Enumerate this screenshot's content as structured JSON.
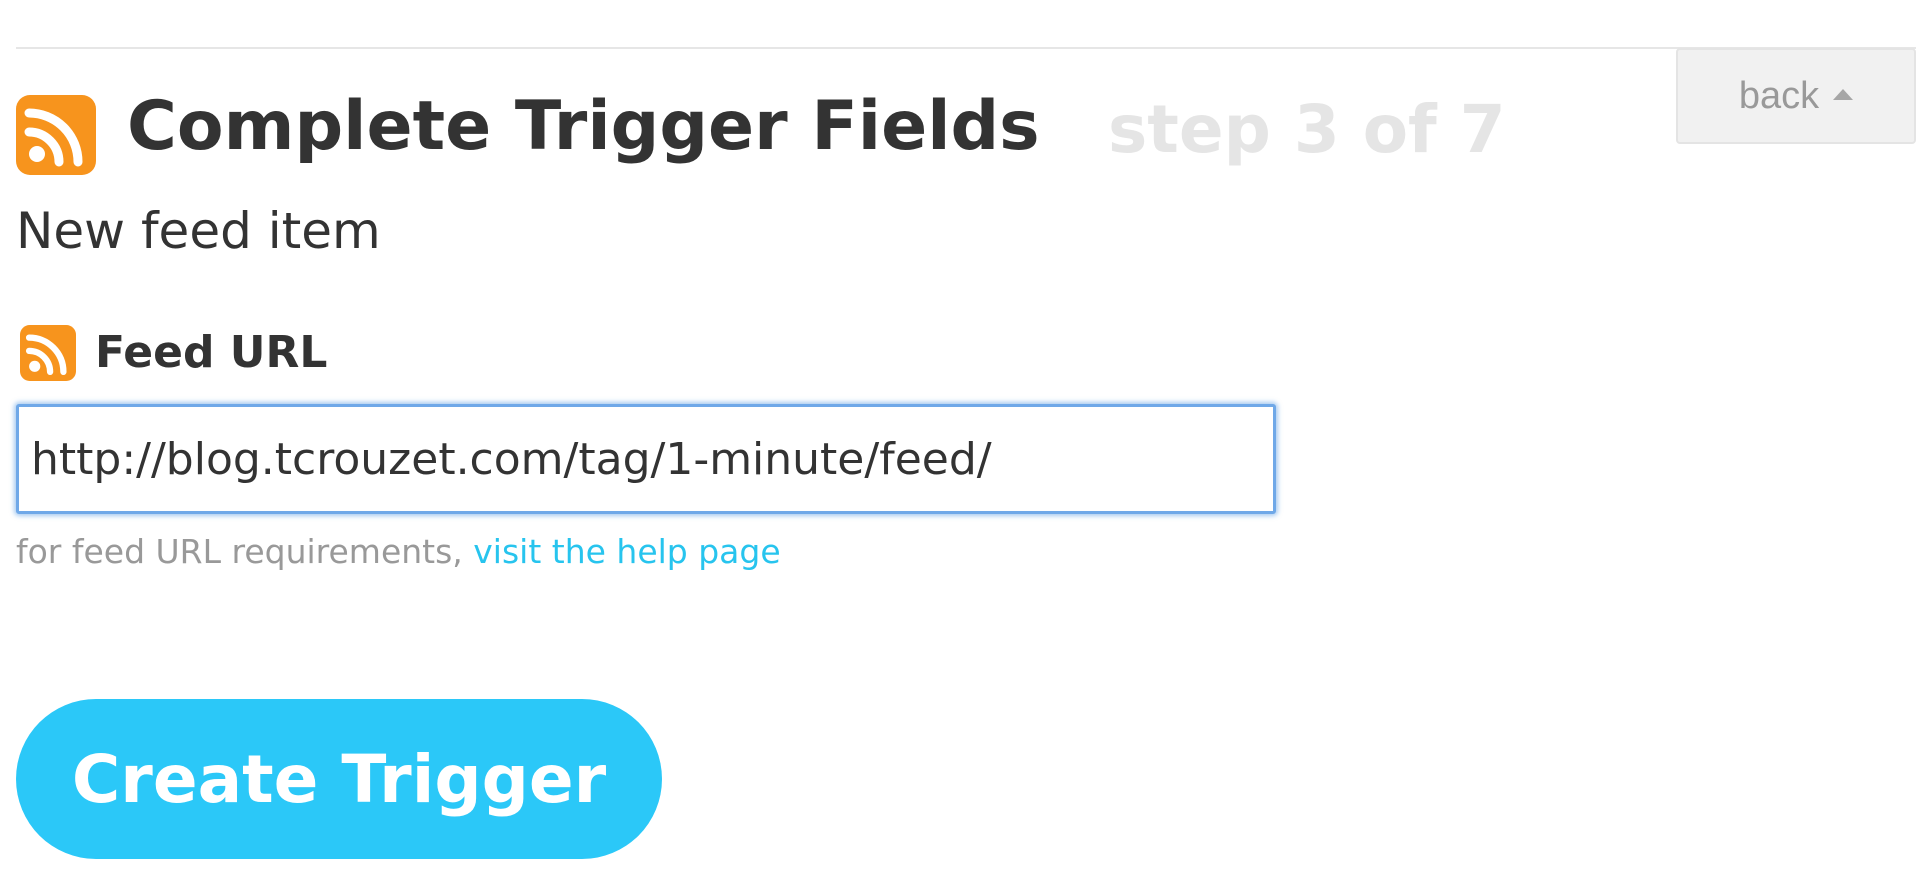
{
  "header": {
    "title": "Complete Trigger Fields",
    "step": "step 3 of 7",
    "back_label": "back",
    "channel_icon": "rss-icon",
    "back_icon": "caret-up-icon"
  },
  "trigger": {
    "name": "New feed item"
  },
  "field": {
    "label": "Feed URL",
    "icon": "rss-icon",
    "value": "http://blog.tcrouzet.com/tag/1-minute/feed/",
    "help_prefix": "for feed URL requirements, ",
    "help_link": "visit the help page"
  },
  "actions": {
    "create_label": "Create Trigger"
  },
  "colors": {
    "rss_orange": "#f7941d",
    "accent_blue": "#2bc8f8",
    "link_blue": "#27c4ee",
    "focus_border": "#6fa8e8",
    "title_text": "#333333",
    "muted_text": "#999999",
    "step_text": "#e5e5e5"
  }
}
